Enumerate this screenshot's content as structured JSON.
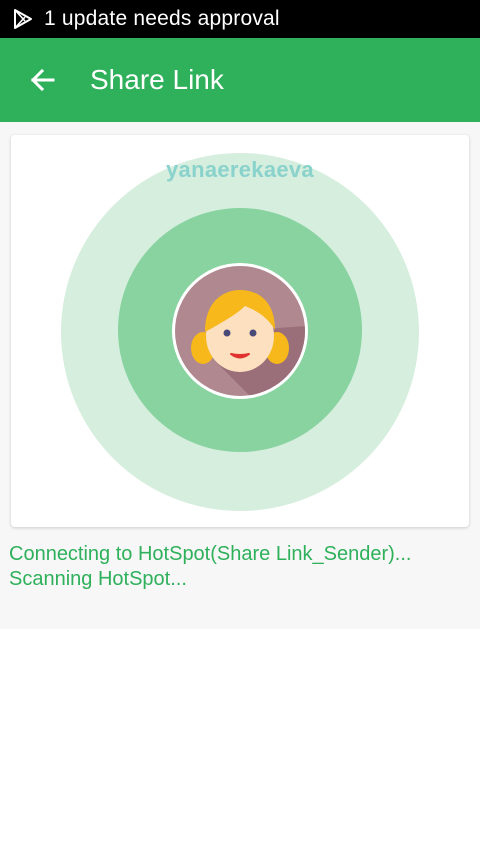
{
  "status_bar": {
    "notification_icon": "play-store-icon",
    "text": "1 update needs approval"
  },
  "app_bar": {
    "back_icon": "arrow-back-icon",
    "title": "Share Link"
  },
  "radar": {
    "device_name": "yanaerekaeva",
    "avatar_icon": "girl-avatar-icon"
  },
  "status_messages": {
    "line1": "Connecting to HotSpot(Share Link_Sender)...",
    "line2": "Scanning HotSpot..."
  },
  "colors": {
    "accent": "#2fb05b",
    "outer_ring": "#d5eedd",
    "inner_ring": "#88d3a0",
    "device_name": "#8ad2cc"
  }
}
